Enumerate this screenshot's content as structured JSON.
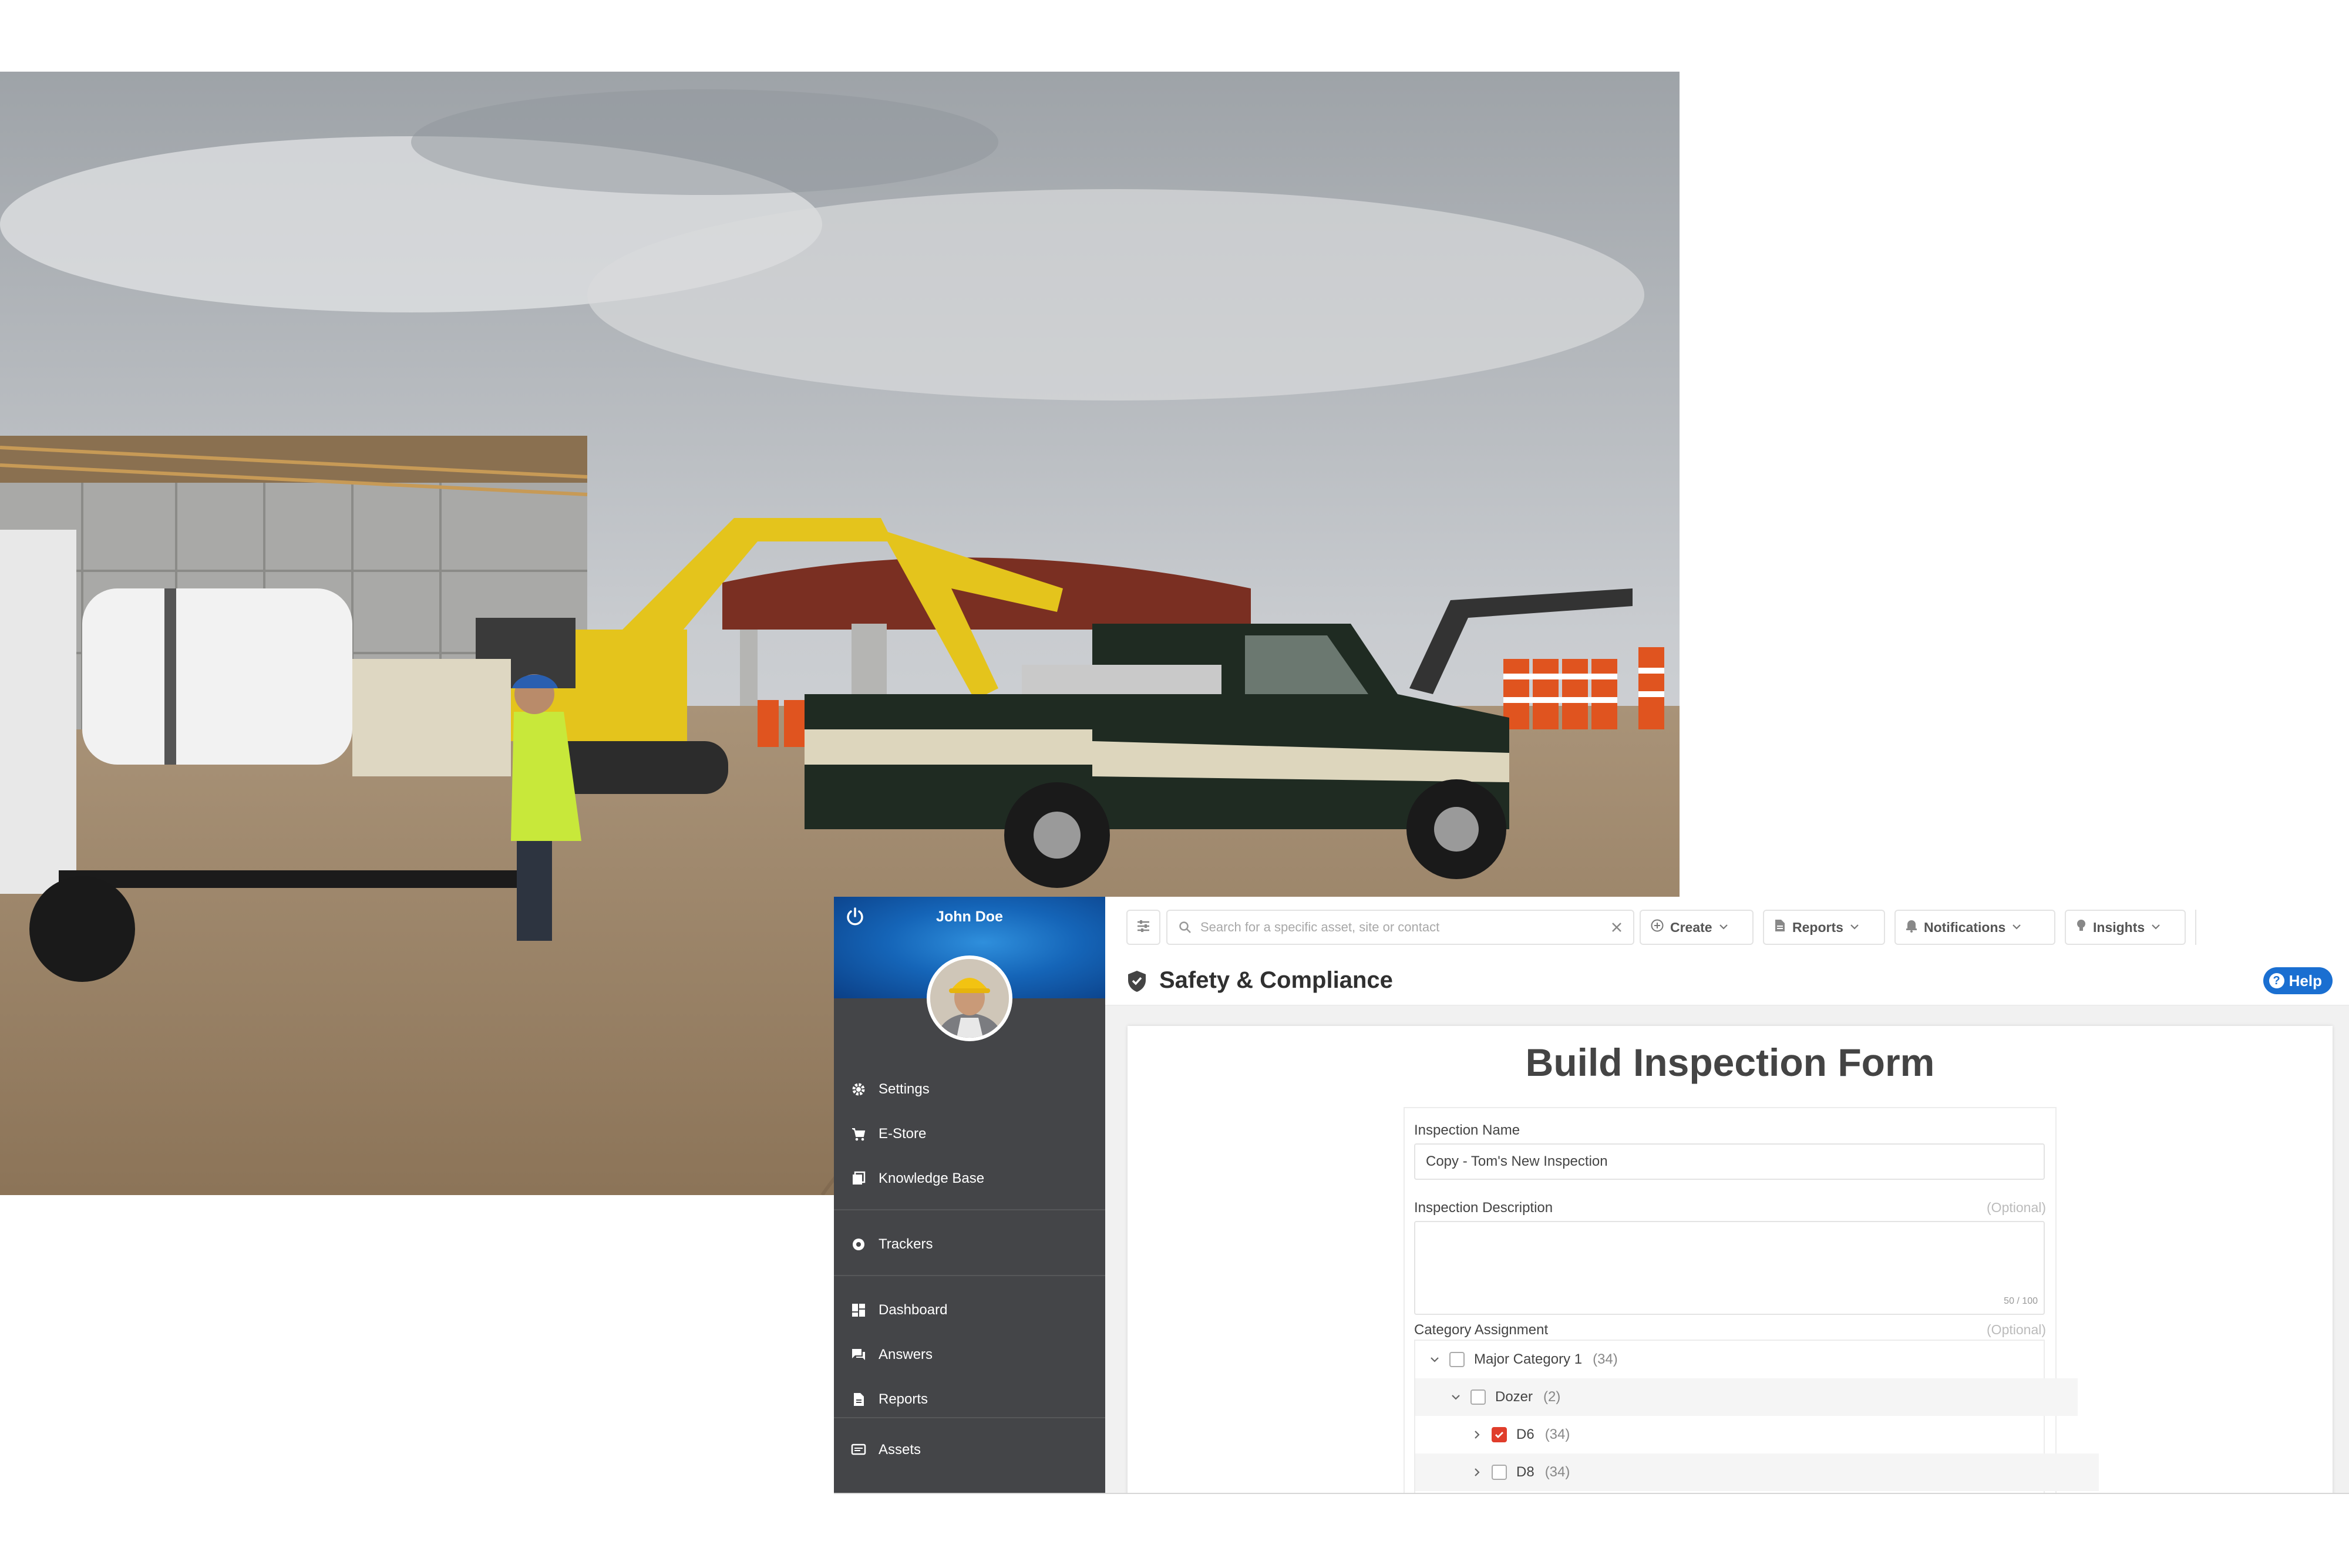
{
  "sidebar": {
    "user_name": "John Doe",
    "items": [
      {
        "label": "Settings",
        "icon": "gear-icon"
      },
      {
        "label": "E-Store",
        "icon": "cart-icon"
      },
      {
        "label": "Knowledge Base",
        "icon": "book-icon"
      },
      {
        "label": "Trackers",
        "icon": "tracker-icon"
      },
      {
        "label": "Dashboard",
        "icon": "dashboard-icon"
      },
      {
        "label": "Answers",
        "icon": "chat-icon"
      },
      {
        "label": "Reports",
        "icon": "document-icon"
      },
      {
        "label": "Assets",
        "icon": "asset-icon"
      }
    ]
  },
  "toolbar": {
    "search_placeholder": "Search for a specific asset, site or contact",
    "create_label": "Create",
    "reports_label": "Reports",
    "notifications_label": "Notifications",
    "insights_label": "Insights"
  },
  "header": {
    "title": "Safety & Compliance",
    "help_label": "Help"
  },
  "form": {
    "title": "Build Inspection Form",
    "name_label": "Inspection Name",
    "name_value": "Copy - Tom's New Inspection",
    "description_label": "Inspection Description",
    "description_optional": "(Optional)",
    "description_count": "50 / 100",
    "category_label": "Category Assignment",
    "category_optional": "(Optional)",
    "categories": [
      {
        "label": "Major Category 1",
        "count": "(34)",
        "checked": false,
        "expanded": true
      },
      {
        "label": "Dozer",
        "count": "(2)",
        "checked": false,
        "expanded": true
      },
      {
        "label": "D6",
        "count": "(34)",
        "checked": true,
        "expanded": false
      },
      {
        "label": "D8",
        "count": "(34)",
        "checked": false,
        "expanded": false
      }
    ]
  },
  "colors": {
    "accent": "#1a6fd1",
    "sidebar": "#444548",
    "checkbox_checked": "#e03d2b"
  }
}
